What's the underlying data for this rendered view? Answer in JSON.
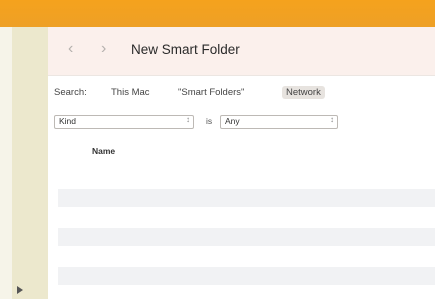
{
  "window": {
    "title": "New Smart Folder"
  },
  "navigation": {
    "back_icon": "chevron-left",
    "forward_icon": "chevron-right"
  },
  "search_scope": {
    "label": "Search:",
    "options": [
      "This Mac",
      "\"Smart Folders\"",
      "Network"
    ],
    "selected": "Network"
  },
  "criteria": {
    "attribute": "Kind",
    "operator": "is",
    "value": "Any"
  },
  "results": {
    "column_header": "Name",
    "rows": []
  },
  "colors": {
    "accent_top": "#f5a21d",
    "sidebar": "#ece8cd",
    "titlebar": "#fbf0ec",
    "row_stripe": "#f1f2f4"
  }
}
